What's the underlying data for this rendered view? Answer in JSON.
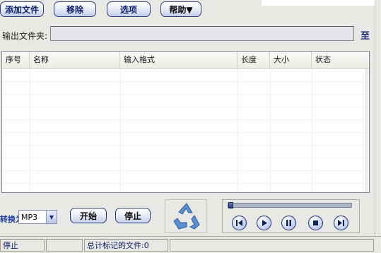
{
  "toolbar": {
    "add_files_label": "添加文件",
    "remove_label": "移除",
    "options_label": "选项",
    "help_label": "帮助▼"
  },
  "output": {
    "label": "输出文件夹:",
    "value": "",
    "go_label": "至"
  },
  "table": {
    "headers": [
      "序号",
      "名称",
      "输入格式",
      "长度",
      "大小",
      "状态"
    ],
    "rows": []
  },
  "convert": {
    "label": "转换为",
    "format": "MP3",
    "start_label": "开始",
    "stop_label": "停止"
  },
  "player": {
    "progress": 0,
    "buttons": [
      "previous-icon",
      "play-icon",
      "pause-icon",
      "stop-icon",
      "next-icon"
    ]
  },
  "status": {
    "state": "停止",
    "marked_files": "总计标记的文件:0"
  },
  "colors": {
    "accent": "#0a1f6a",
    "button_border": "#2a3f7a",
    "recycle": "#5a8fd0",
    "background": "#e8e8e4"
  }
}
